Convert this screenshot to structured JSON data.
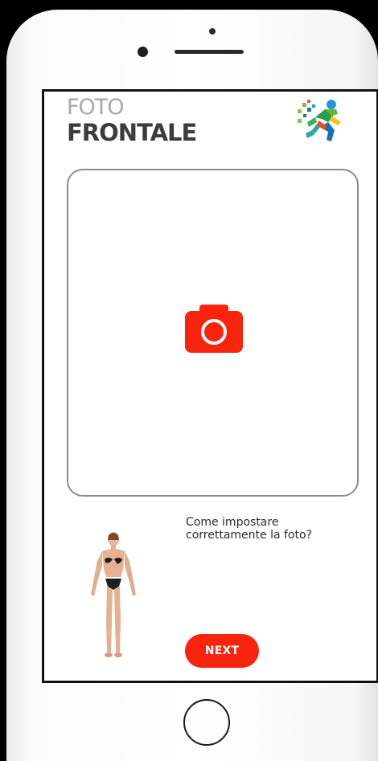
{
  "header": {
    "title_top": "FOTO",
    "title_main": "FRONTALE",
    "logo": "runner-figure-logo"
  },
  "photo_area": {
    "camera_icon": "camera-icon",
    "accent_color": "#f8240e"
  },
  "help": {
    "text_line1": "Come impostare",
    "text_line2": "correttamente la foto?",
    "figure": "body-pose-figure"
  },
  "actions": {
    "next_label": "NEXT"
  },
  "device": {
    "home_button": "home-button"
  }
}
